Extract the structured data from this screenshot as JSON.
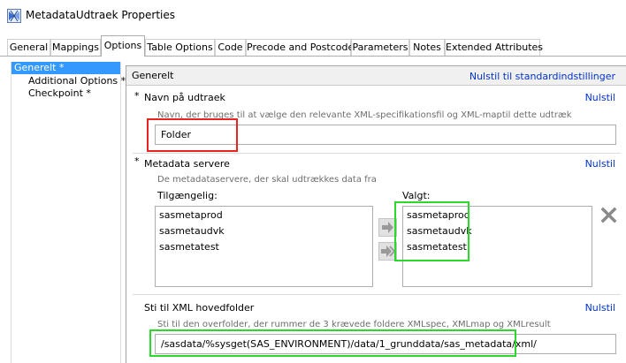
{
  "window": {
    "title": "MetadataUdtraek Properties"
  },
  "tabs": [
    {
      "label": "General"
    },
    {
      "label": "Mappings"
    },
    {
      "label": "Options"
    },
    {
      "label": "Table Options"
    },
    {
      "label": "Code"
    },
    {
      "label": "Precode and Postcode"
    },
    {
      "label": "Parameters"
    },
    {
      "label": "Notes"
    },
    {
      "label": "Extended Attributes"
    }
  ],
  "nav": {
    "items": [
      {
        "label": "Generelt *"
      },
      {
        "label": "Additional Options *"
      },
      {
        "label": "Checkpoint *"
      }
    ]
  },
  "panel": {
    "header_title": "Generelt",
    "reset_all_label": "Nulstil til standardindstillinger",
    "name_section": {
      "required_mark": "*",
      "label": "Navn på udtraek",
      "reset_label": "Nulstil",
      "hint": "Navn, der bruges til at vælge den relevante XML-specifikationsfil og XML-maptil dette udtræk",
      "value": "Folder"
    },
    "servers_section": {
      "required_mark": "*",
      "label": "Metadata servere",
      "reset_label": "Nulstil",
      "hint": "De metadataservere, der skal udtrækkes data fra",
      "available_label": "Tilgængelig:",
      "selected_label": "Valgt:",
      "available": [
        "sasmetaprod",
        "sasmetaudvk",
        "sasmetatest"
      ],
      "selected": [
        "sasmetaprod",
        "sasmetaudvk",
        "sasmetatest"
      ]
    },
    "xml_section": {
      "label": "Sti til XML hovedfolder",
      "reset_label": "Nulstil",
      "hint": "Sti til den overfolder, der rummer de 3 krævede foldere XMLspec, XMLmap og XMLresult",
      "value": "/sasdata/%sysget(SAS_ENVIRONMENT)/data/1_grunddata/sas_metadata/xml/"
    }
  },
  "colors": {
    "selection": "#3399ff",
    "link": "#0033cc",
    "highlight_red": "#e8241f",
    "highlight_green": "#2cd82c"
  }
}
